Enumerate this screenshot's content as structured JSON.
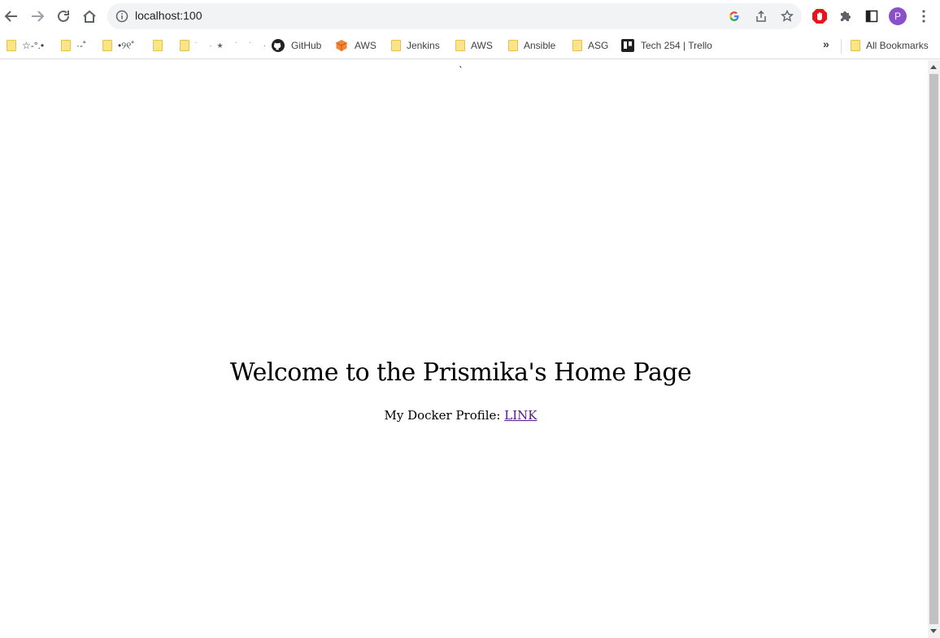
{
  "browser": {
    "url": "localhost:100",
    "avatar_letter": "P",
    "accent_colors": {
      "avatar": "#8a4fc9",
      "folder": "#fde48a",
      "visited_link": "#551a8b"
    }
  },
  "bookmarks": {
    "items": [
      {
        "label": "☆-°.•",
        "icon": "folder-icon"
      },
      {
        "label": "·-˚",
        "icon": "folder-icon"
      },
      {
        "label": "•୨୧˚",
        "icon": "folder-icon"
      },
      {
        "label": "",
        "icon": "folder-icon"
      },
      {
        "label": "˙ ·★ ˙ ˙ ·",
        "icon": "folder-icon"
      },
      {
        "label": "GitHub",
        "icon": "github-icon"
      },
      {
        "label": "AWS",
        "icon": "aws-cube-icon"
      },
      {
        "label": "Jenkins",
        "icon": "folder-icon"
      },
      {
        "label": "AWS",
        "icon": "folder-icon"
      },
      {
        "label": "Ansible",
        "icon": "folder-icon"
      },
      {
        "label": "ASG",
        "icon": "folder-icon"
      },
      {
        "label": "Tech 254 | Trello",
        "icon": "trello-icon"
      }
    ],
    "overflow": "»",
    "all_bookmarks": "All Bookmarks"
  },
  "page": {
    "stray_char": "`",
    "heading": "Welcome to the Prismika's Home Page",
    "profile_text": "My Docker Profile: ",
    "profile_link": "LINK"
  }
}
